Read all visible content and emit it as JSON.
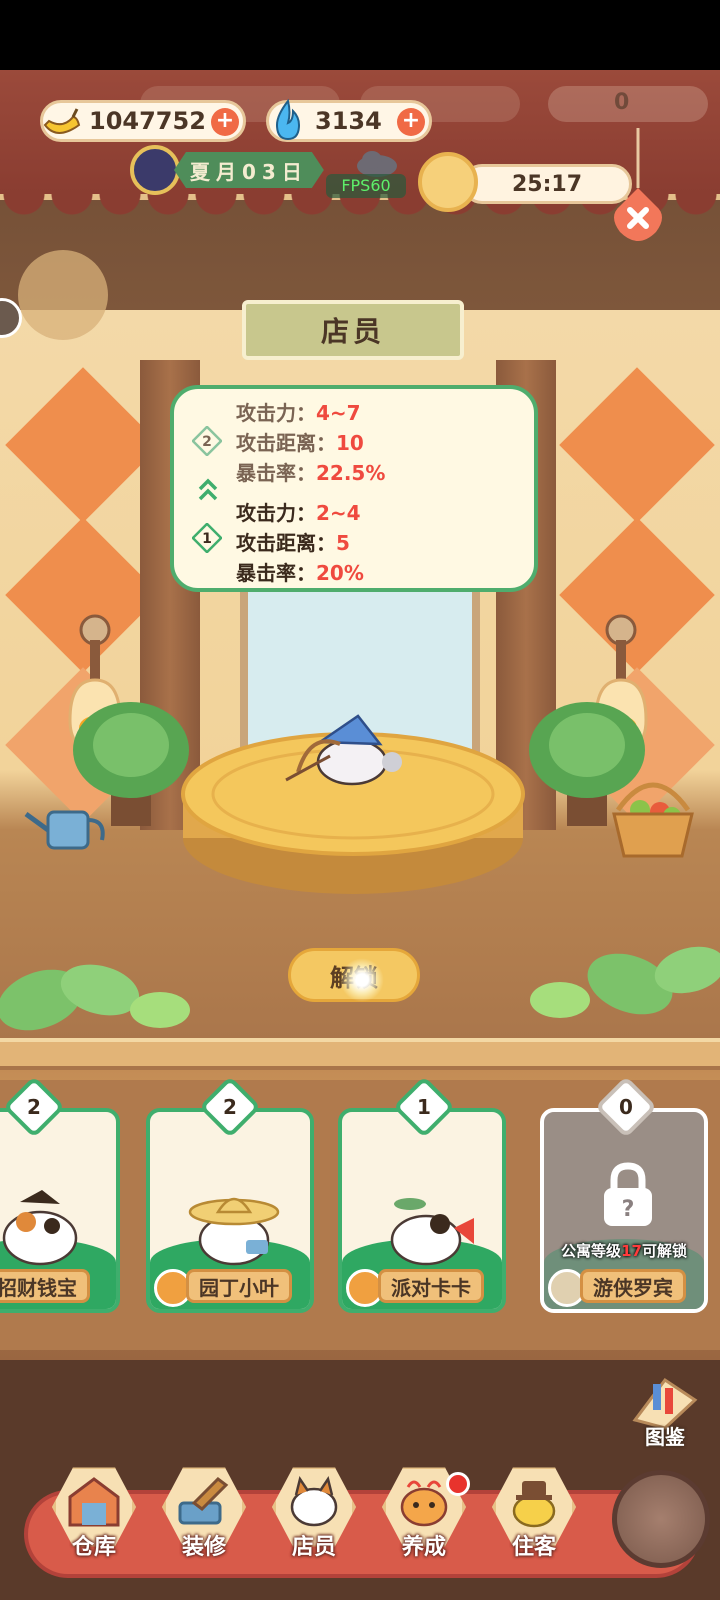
{
  "resources": {
    "banana": {
      "value": "1047752",
      "icon": "banana-icon"
    },
    "gem": {
      "value": "3134",
      "icon": "blue-flame-icon"
    }
  },
  "ghost_values": {
    "banana": "1047752",
    "gem": "3134",
    "fish": "0"
  },
  "date": {
    "text": "夏月03日"
  },
  "fps": "FPS60",
  "timer": {
    "text": "25:17"
  },
  "panel": {
    "title": "店员"
  },
  "stats": {
    "next": {
      "level": "2",
      "attack_label": "攻击力：",
      "attack_value": "4~7",
      "range_label": "攻击距离：",
      "range_value": "10",
      "crit_label": "暴击率：",
      "crit_value": "22.5%"
    },
    "current": {
      "level": "1",
      "attack_label": "攻击力：",
      "attack_value": "2~4",
      "range_label": "攻击距离：",
      "range_value": "5",
      "crit_label": "暴击率：",
      "crit_value": "20%"
    }
  },
  "unlock_button": "解锁",
  "cards": [
    {
      "count": "2",
      "name": "招财钱宝",
      "locked": false
    },
    {
      "count": "2",
      "name": "园丁小叶",
      "locked": false
    },
    {
      "count": "1",
      "name": "派对卡卡",
      "locked": false
    },
    {
      "count": "0",
      "name": "游侠罗宾",
      "locked": true,
      "lock_text_pre": "公寓等级",
      "lock_level": "17",
      "lock_text_post": "可解锁"
    }
  ],
  "atlas": "图鉴",
  "nav": [
    {
      "label": "仓库",
      "icon": "warehouse-icon"
    },
    {
      "label": "装修",
      "icon": "decorate-icon"
    },
    {
      "label": "店员",
      "icon": "staff-icon"
    },
    {
      "label": "养成",
      "icon": "nurture-icon"
    },
    {
      "label": "住客",
      "icon": "guest-icon"
    }
  ],
  "colors": {
    "accent_green": "#3fae6d",
    "stat_red": "#ef4a3f",
    "nav_red": "#d85b4a"
  }
}
